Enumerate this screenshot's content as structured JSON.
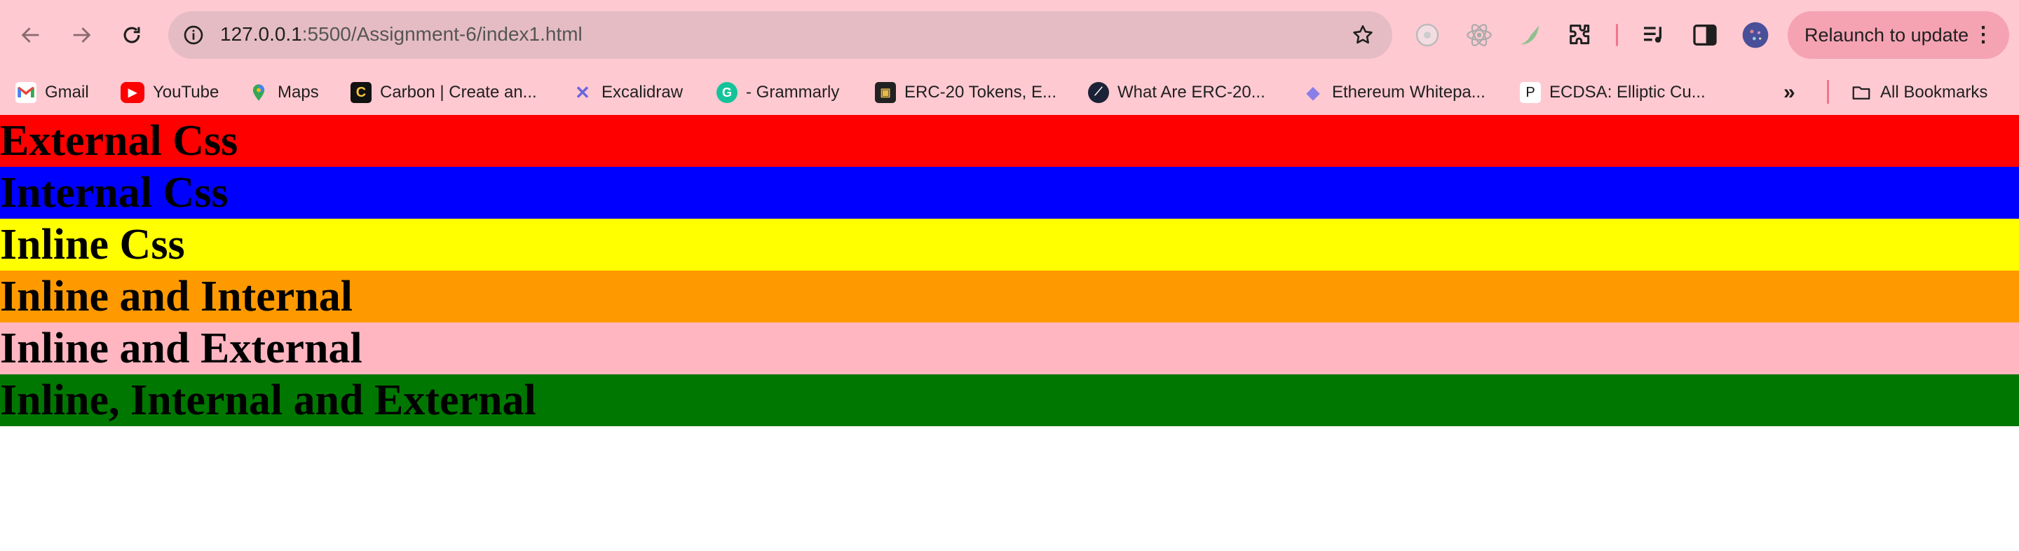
{
  "browser": {
    "url_host": "127.0.0.1",
    "url_path": ":5500/Assignment-6/index1.html",
    "relaunch_label": "Relaunch to update",
    "bookmarks": [
      {
        "label": "Gmail"
      },
      {
        "label": "YouTube"
      },
      {
        "label": "Maps"
      },
      {
        "label": "Carbon | Create an..."
      },
      {
        "label": "Excalidraw"
      },
      {
        "label": "- Grammarly"
      },
      {
        "label": "ERC-20 Tokens, E..."
      },
      {
        "label": "What Are ERC-20..."
      },
      {
        "label": "Ethereum Whitepa..."
      },
      {
        "label": "ECDSA: Elliptic Cu..."
      }
    ],
    "all_bookmarks_label": "All Bookmarks"
  },
  "page": {
    "headings": [
      {
        "text": "External Css",
        "color": "#ff0000"
      },
      {
        "text": "Internal Css",
        "color": "#0000ff"
      },
      {
        "text": "Inline Css",
        "color": "#ffff00"
      },
      {
        "text": "Inline and Internal",
        "color": "#ff9900"
      },
      {
        "text": "Inline and External",
        "color": "#ffb6c1"
      },
      {
        "text": "Inline, Internal and External",
        "color": "#007700"
      }
    ]
  }
}
